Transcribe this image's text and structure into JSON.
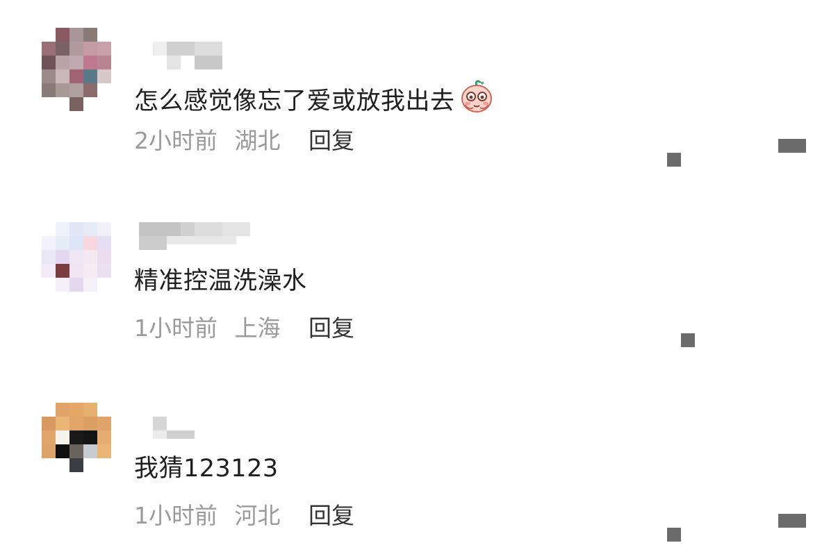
{
  "comments": [
    {
      "text": "怎么感觉像忘了爱或放我出去",
      "time": "2小时前",
      "location": "湖北",
      "reply_label": "回复",
      "sticker": "blushing-peach-sticker"
    },
    {
      "text": "精准控温洗澡水",
      "time": "1小时前",
      "location": "上海",
      "reply_label": "回复"
    },
    {
      "text": "我猜123123",
      "time": "1小时前",
      "location": "河北",
      "reply_label": "回复"
    }
  ],
  "colors": {
    "text": "#1f1f1f",
    "meta": "#9a9a9a",
    "reply": "#333333",
    "background": "#ffffff"
  }
}
